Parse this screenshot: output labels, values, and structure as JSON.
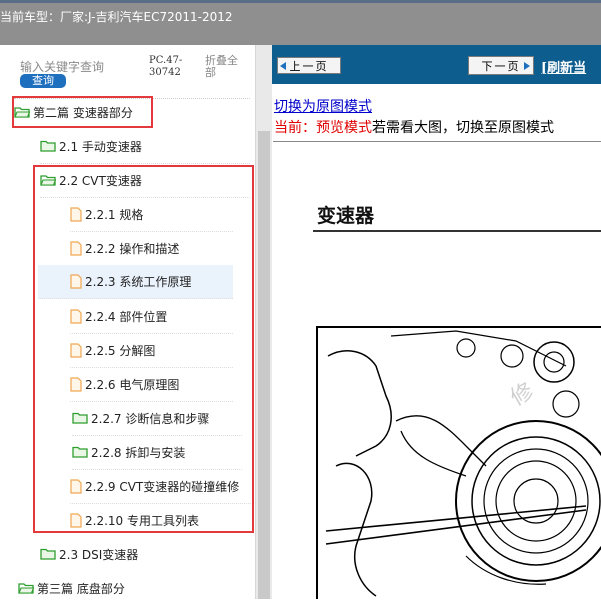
{
  "window": {
    "vehicle_label": "当前车型：",
    "vehicle_value": "厂家:J-吉利汽车EC72011-2012"
  },
  "sidebar": {
    "search_placeholder": "输入关键字查询",
    "query_button": "查询",
    "pc_code": "PC.47-30742",
    "fold_all": "折叠全部",
    "tree": [
      {
        "label": "第二篇 变速器部分",
        "icon": "folder-open-icon"
      },
      {
        "label": "2.1 手动变速器",
        "icon": "folder-icon"
      },
      {
        "label": "2.2 CVT变速器",
        "icon": "folder-open-icon"
      },
      {
        "label": "2.2.1 规格",
        "icon": "document-icon"
      },
      {
        "label": "2.2.2 操作和描述",
        "icon": "document-icon"
      },
      {
        "label": "2.2.3 系统工作原理",
        "icon": "document-icon"
      },
      {
        "label": "2.2.4 部件位置",
        "icon": "document-icon"
      },
      {
        "label": "2.2.5 分解图",
        "icon": "document-icon"
      },
      {
        "label": "2.2.6 电气原理图",
        "icon": "document-icon"
      },
      {
        "label": "2.2.7 诊断信息和步骤",
        "icon": "folder-icon"
      },
      {
        "label": "2.2.8 拆卸与安装",
        "icon": "folder-icon"
      },
      {
        "label": "2.2.9 CVT变速器的碰撞维修",
        "icon": "document-icon"
      },
      {
        "label": "2.2.10 专用工具列表",
        "icon": "document-icon"
      },
      {
        "label": "2.3 DSI变速器",
        "icon": "folder-icon"
      },
      {
        "label": "第三篇 底盘部分",
        "icon": "folder-open-icon"
      }
    ]
  },
  "content": {
    "prev_button": "上一页",
    "next_button": "下一页",
    "refresh_link": "[刷新当",
    "switch_link": "切换为原图模式",
    "mode_prefix": "当前：预览模式",
    "mode_suffix": "若需看大图，切换至原图模式",
    "doc_title": "变速器"
  },
  "colors": {
    "highlight_red": "#e4393c",
    "nav_blue": "#0d5d8f",
    "folder_green": "#2e9e2e",
    "doc_orange": "#f0a650"
  }
}
